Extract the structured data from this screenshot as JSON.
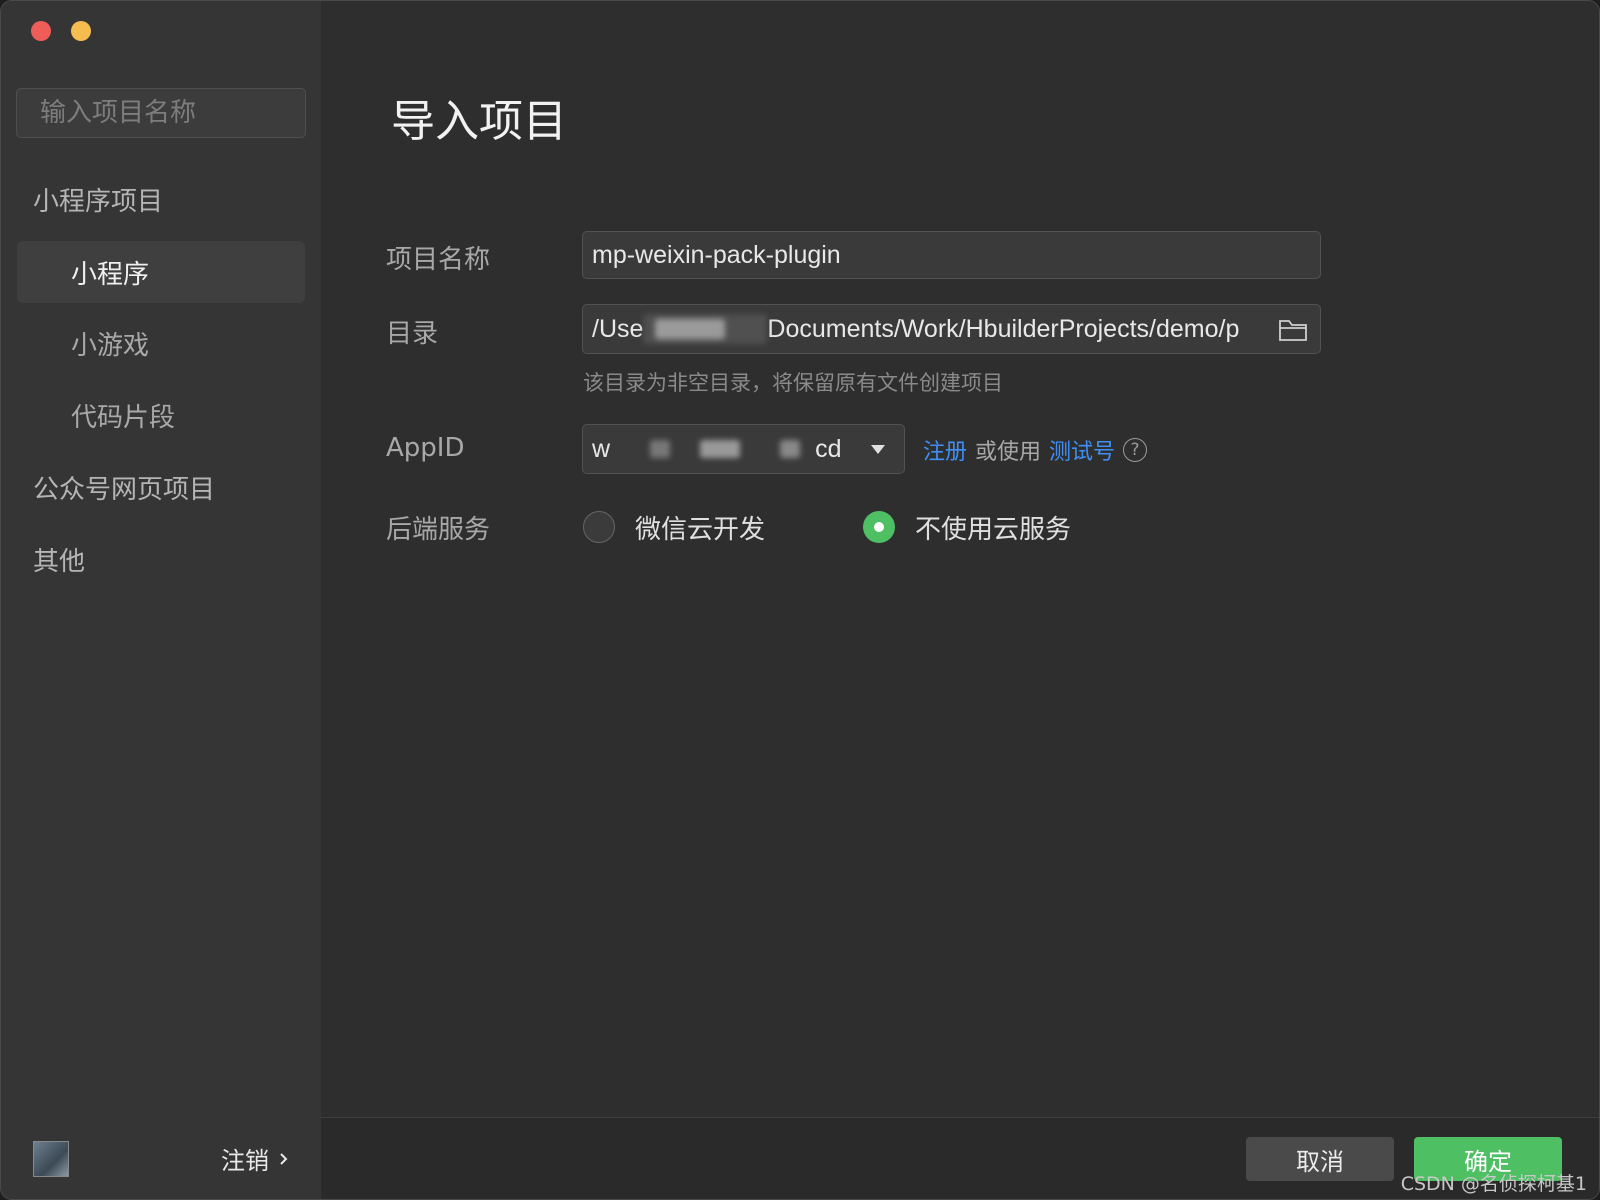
{
  "sidebar": {
    "search_placeholder": "输入项目名称",
    "groups": [
      {
        "label": "小程序项目"
      },
      {
        "label": "公众号网页项目"
      },
      {
        "label": "其他"
      }
    ],
    "items": [
      {
        "label": "小程序",
        "active": true
      },
      {
        "label": "小游戏",
        "active": false
      },
      {
        "label": "代码片段",
        "active": false
      }
    ],
    "logout_label": "注销"
  },
  "main": {
    "title": "导入项目",
    "project_name_label": "项目名称",
    "project_name_value": "mp-weixin-pack-plugin",
    "directory_label": "目录",
    "directory_prefix": "/Use",
    "directory_suffix": "Documents/Work/HbuilderProjects/demo/p",
    "directory_hint": "该目录为非空目录，将保留原有文件创建项目",
    "appid_label": "AppID",
    "appid_prefix": "w",
    "appid_suffix": "cd",
    "register_link": "注册",
    "or_use_text": "或使用",
    "test_account_link": "测试号",
    "backend_label": "后端服务",
    "backend_options": [
      {
        "label": "微信云开发",
        "selected": false
      },
      {
        "label": "不使用云服务",
        "selected": true
      }
    ]
  },
  "footer": {
    "cancel_label": "取消",
    "ok_label": "确定"
  },
  "watermark": "CSDN @名侦探柯基1",
  "colors": {
    "accent_green": "#4fbf64",
    "link_blue": "#3f8ff5"
  }
}
